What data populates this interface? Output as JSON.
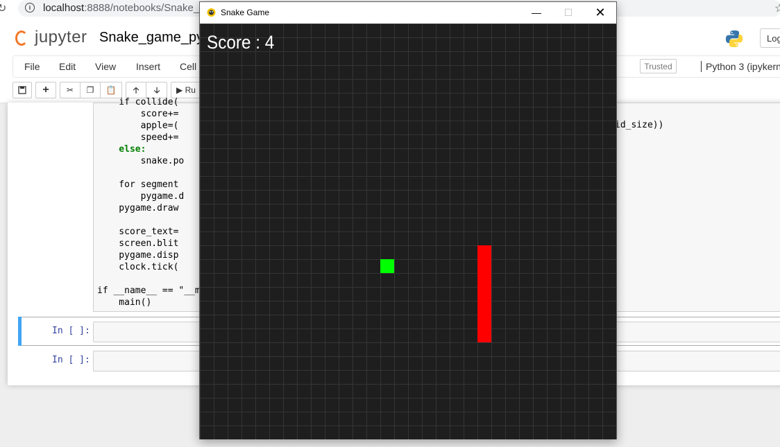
{
  "browser": {
    "url_host": "localhost",
    "url_rest": ":8888/notebooks/Snake_ga"
  },
  "jupyter": {
    "logo_text": "jupyter",
    "notebook_name": "Snake_game_py",
    "logout_label": "Log",
    "menu": [
      "File",
      "Edit",
      "View",
      "Insert",
      "Cell"
    ],
    "trusted_label": "Trusted",
    "kernel_label": "Python 3 (ipykerne",
    "run_label": "Ru"
  },
  "cells": {
    "code_lines": [
      "    if collide(",
      "        score+=",
      "        apple=(",
      "        speed+=",
      "    else:",
      "        snake.po",
      "",
      "    for segment",
      "        pygame.d",
      "    pygame.draw",
      "",
      "    score_text=",
      "    screen.blit",
      "    pygame.disp",
      "    clock.tick(",
      "",
      "if __name__ == \"__ma",
      "    main()"
    ],
    "code_tail": "id_size))",
    "prompt_1": "In [ ]:",
    "prompt_2": "In [ ]:"
  },
  "game_window": {
    "title": "Snake Game",
    "minimize_icon": "minimize-icon",
    "maximize_icon": "maximize-icon",
    "close_icon": "close-icon",
    "score_text": "Score : 4",
    "grid_cell_size": 20,
    "grid_cols": 30,
    "grid_rows": 30,
    "apple_cell": [
      13,
      17
    ],
    "snake_cells": [
      [
        20,
        16
      ],
      [
        20,
        17
      ],
      [
        20,
        18
      ],
      [
        20,
        19
      ],
      [
        20,
        20
      ],
      [
        20,
        21
      ],
      [
        20,
        22
      ]
    ],
    "colors": {
      "background": "#1e1e1e",
      "grid_line": "#353535",
      "apple": "#00ff00",
      "snake": "#ff0000",
      "score_text": "#ffffff"
    }
  }
}
